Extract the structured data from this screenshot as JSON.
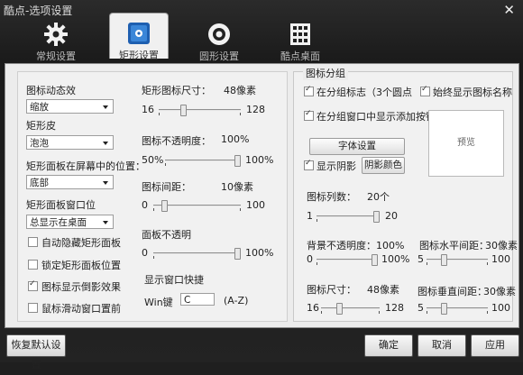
{
  "window": {
    "title": "酷点-选项设置"
  },
  "tabs": [
    {
      "label": "常规设置",
      "icon": "gear-icon"
    },
    {
      "label": "矩形设置",
      "icon": "square-settings-icon"
    },
    {
      "label": "圆形设置",
      "icon": "circle-settings-icon"
    },
    {
      "label": "酷点桌面",
      "icon": "desktop-grid-icon"
    }
  ],
  "left": {
    "icon_effect_label": "图标动态效",
    "icon_effect_value": "缩放",
    "skin_label": "矩形皮",
    "skin_value": "泡泡",
    "position_label": "矩形面板在屏幕中的位置：",
    "position_value": "底部",
    "window_pos_label": "矩形面板窗口位",
    "window_pos_value": "总显示在桌面",
    "checks": [
      {
        "label": "自动隐藏矩形面板",
        "checked": false
      },
      {
        "label": "锁定矩形面板位置",
        "checked": false
      },
      {
        "label": "图标显示倒影效果",
        "checked": true
      },
      {
        "label": "鼠标滑动窗口置前",
        "checked": false
      }
    ],
    "icon_size": {
      "label": "矩形图标尺寸：",
      "value": "48像素",
      "min": "16",
      "max": "128",
      "current": 48,
      "range": [
        16,
        128
      ]
    },
    "opacity": {
      "label": "图标不透明度：",
      "value": "100%",
      "min": "50%",
      "max": "100%",
      "current": 100,
      "range": [
        50,
        100
      ]
    },
    "spacing": {
      "label": "图标间距：",
      "value": "10像素",
      "min": "0",
      "max": "100",
      "current": 10,
      "range": [
        0,
        100
      ]
    },
    "panel_opacity": {
      "label": "面板不透明",
      "value": "",
      "min": "0",
      "max": "100%",
      "current": 100,
      "range": [
        0,
        100
      ]
    },
    "hotkey": {
      "label": "显示窗口快捷",
      "prefix": "Win键",
      "key": "C",
      "hint": "(A-Z)"
    }
  },
  "right": {
    "group_title": "图标分组",
    "show_group_marker": {
      "label": "在分组标志（3个圆点",
      "checked": true
    },
    "always_show_name": {
      "label": "始终显示图标名称",
      "checked": true
    },
    "show_add_button": {
      "label": "在分组窗口中显示添加按钮",
      "checked": true
    },
    "font_button": "字体设置",
    "show_shadow": {
      "label": "显示阴影",
      "checked": true
    },
    "shadow_color_button": "阴影颜色",
    "preview_label": "预览",
    "columns": {
      "label": "图标列数：",
      "value": "20个",
      "min": "1",
      "max": "20",
      "current": 20,
      "range": [
        1,
        20
      ]
    },
    "bg_opacity": {
      "label": "背景不透明度：100%",
      "min": "0",
      "max": "100%",
      "current": 100,
      "range": [
        0,
        100
      ]
    },
    "h_spacing": {
      "label": "图标水平间距：",
      "value": "30像素",
      "min": "5",
      "max": "100",
      "current": 30,
      "range": [
        5,
        100
      ]
    },
    "icon_size": {
      "label": "图标尺寸：",
      "value": "48像素",
      "min": "16",
      "max": "128",
      "current": 48,
      "range": [
        16,
        128
      ]
    },
    "v_spacing": {
      "label": "图标垂直间距：",
      "value": "30像素",
      "min": "5",
      "max": "100",
      "current": 30,
      "range": [
        5,
        100
      ]
    }
  },
  "footer": {
    "restore_defaults": "恢复默认设置",
    "ok": "确定",
    "cancel": "取消",
    "apply": "应用"
  }
}
